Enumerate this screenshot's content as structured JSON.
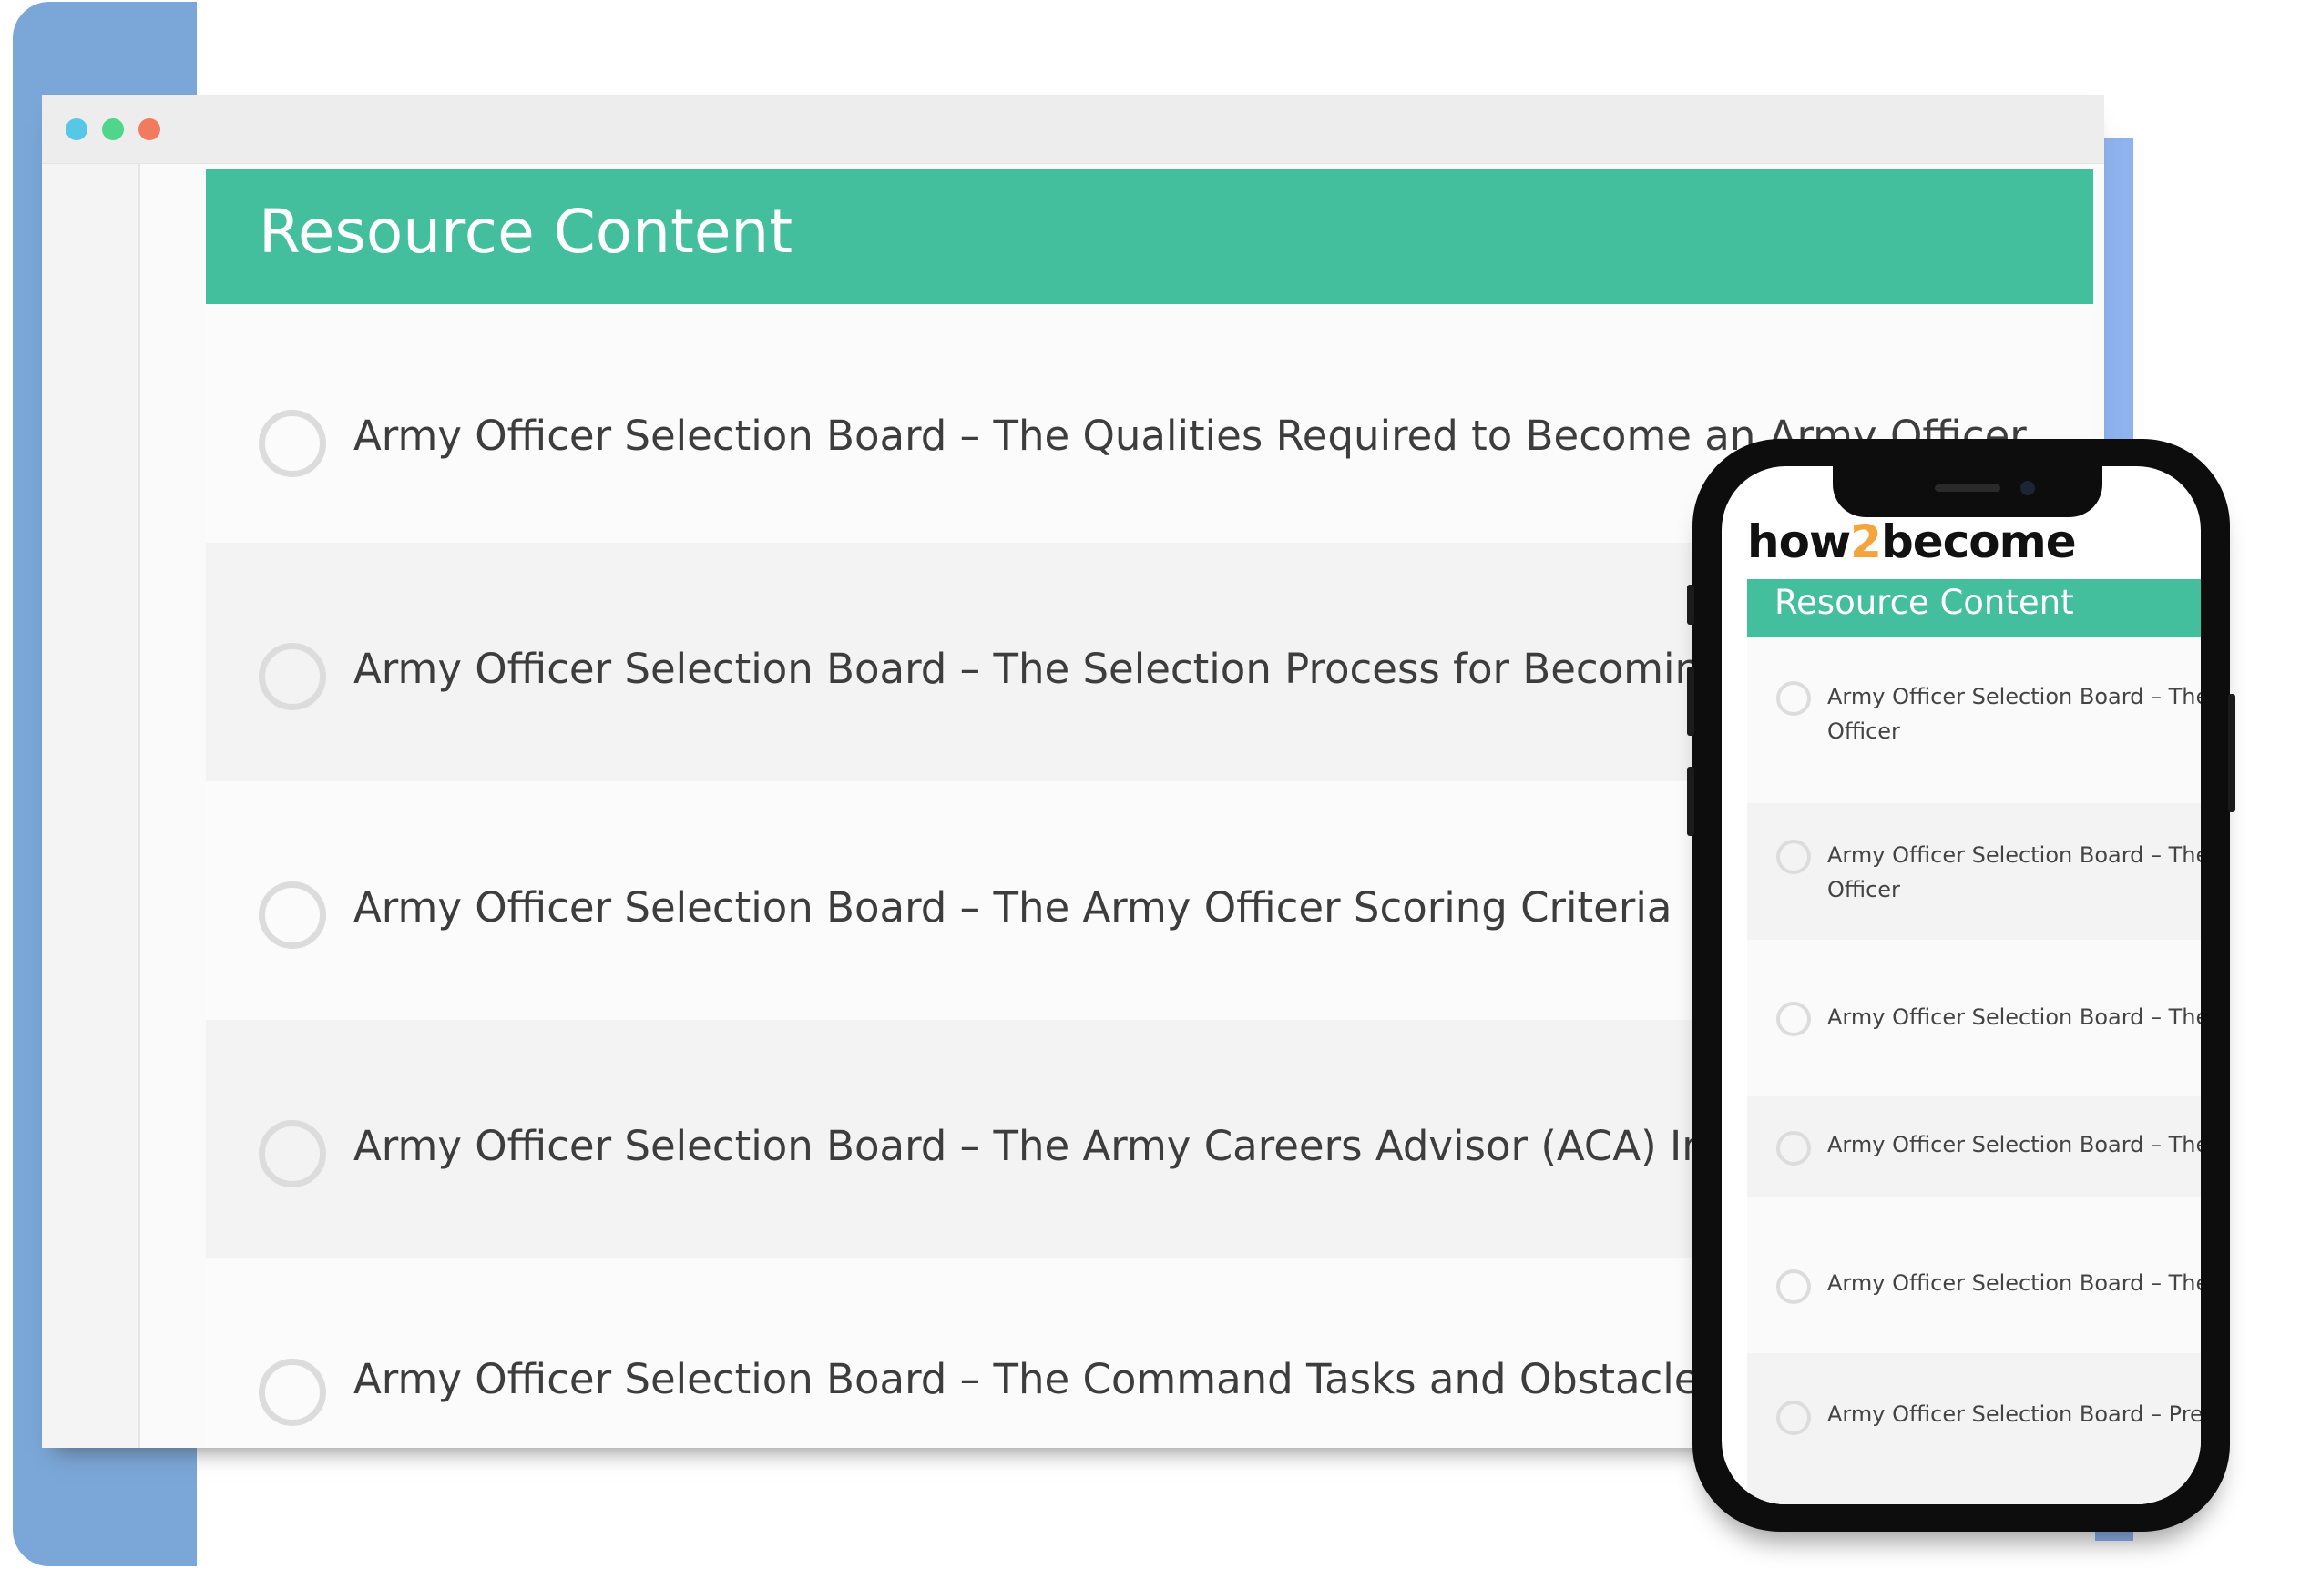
{
  "desktop": {
    "header": {
      "title": "Resource Content"
    },
    "items": [
      {
        "label": "Army Officer Selection Board – The Qualities Required to Become an Army Officer"
      },
      {
        "label": "Army Officer Selection Board – The Selection Process for Becoming an Army Officer"
      },
      {
        "label": "Army Officer Selection Board – The Army Officer Scoring Criteria"
      },
      {
        "label": "Army Officer Selection Board – The Army Careers Advisor (ACA) Interview"
      },
      {
        "label": "Army Officer Selection Board – The Command Tasks and Obstacle Course"
      }
    ]
  },
  "mobile": {
    "brand": {
      "part1": "how",
      "part2": "2",
      "part3": "become"
    },
    "header": {
      "title": "Resource Content"
    },
    "items": [
      {
        "line1": "Army Officer Selection Board – The",
        "line2": "Officer"
      },
      {
        "line1": "Army Officer Selection Board – The",
        "line2": "Officer"
      },
      {
        "line1": "Army Officer Selection Board – The",
        "line2": ""
      },
      {
        "line1": "Army Officer Selection Board – The",
        "line2": ""
      },
      {
        "line1": "Army Officer Selection Board – The",
        "line2": ""
      },
      {
        "line1": "Army Officer Selection Board – Pre",
        "line2": ""
      }
    ]
  },
  "colors": {
    "accent": "#43bf9e",
    "brand_orange": "#f5a33b",
    "backdrop_blue": "#7aa7d8",
    "dot_blue": "#56c7e6",
    "dot_green": "#4fd68a",
    "dot_red": "#f27b5f"
  }
}
